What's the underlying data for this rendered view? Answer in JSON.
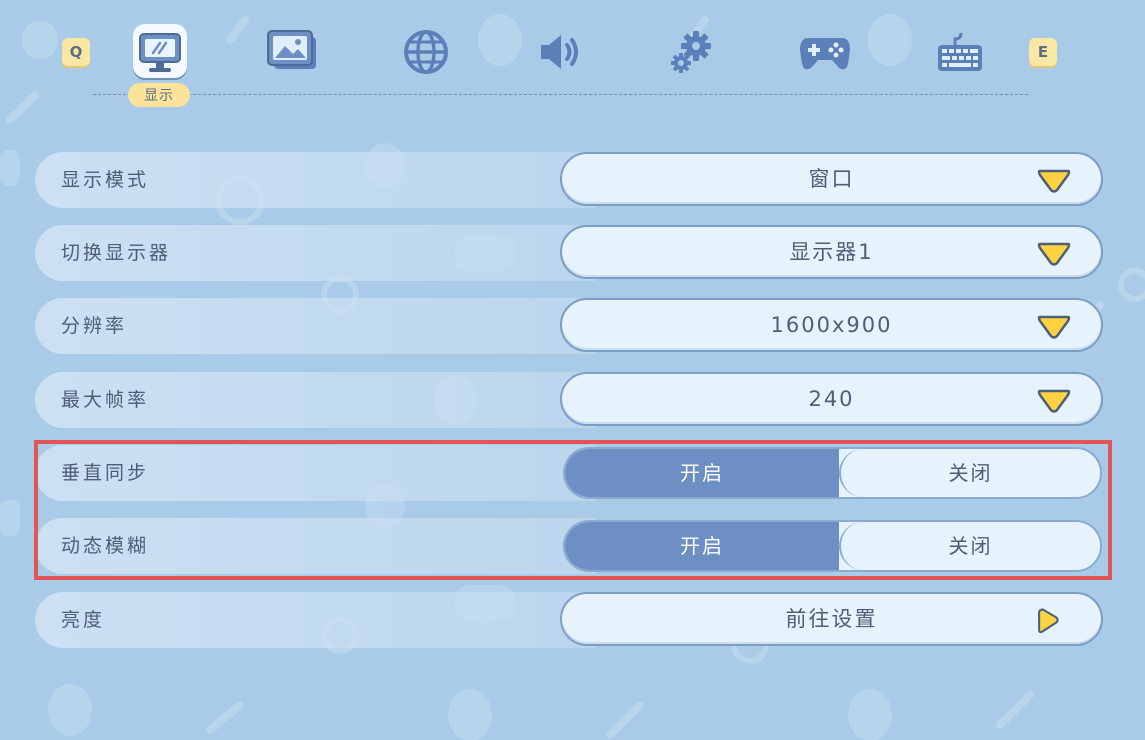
{
  "nav": {
    "left_key": "Q",
    "right_key": "E",
    "active_label": "显示",
    "tabs": [
      {
        "name": "display",
        "icon": "monitor-icon"
      },
      {
        "name": "image",
        "icon": "image-icon"
      },
      {
        "name": "language",
        "icon": "globe-icon"
      },
      {
        "name": "sound",
        "icon": "speaker-icon"
      },
      {
        "name": "system",
        "icon": "gears-icon"
      },
      {
        "name": "controller",
        "icon": "gamepad-icon"
      },
      {
        "name": "keyboard",
        "icon": "keyboard-icon"
      }
    ]
  },
  "settings": {
    "display_mode": {
      "label": "显示模式",
      "value": "窗口"
    },
    "switch_monitor": {
      "label": "切换显示器",
      "value": "显示器1"
    },
    "resolution": {
      "label": "分辨率",
      "value": "1600x900"
    },
    "max_fps": {
      "label": "最大帧率",
      "value": "240"
    },
    "vsync": {
      "label": "垂直同步",
      "on": "开启",
      "off": "关闭",
      "selected": "on"
    },
    "motion_blur": {
      "label": "动态模糊",
      "on": "开启",
      "off": "关闭",
      "selected": "on"
    },
    "brightness": {
      "label": "亮度",
      "value": "前往设置"
    }
  },
  "colors": {
    "background": "#a9cbe7",
    "accent_yellow": "#fbe39a",
    "toggle_active": "#6e8fc3",
    "highlight_box": "#e05555"
  }
}
